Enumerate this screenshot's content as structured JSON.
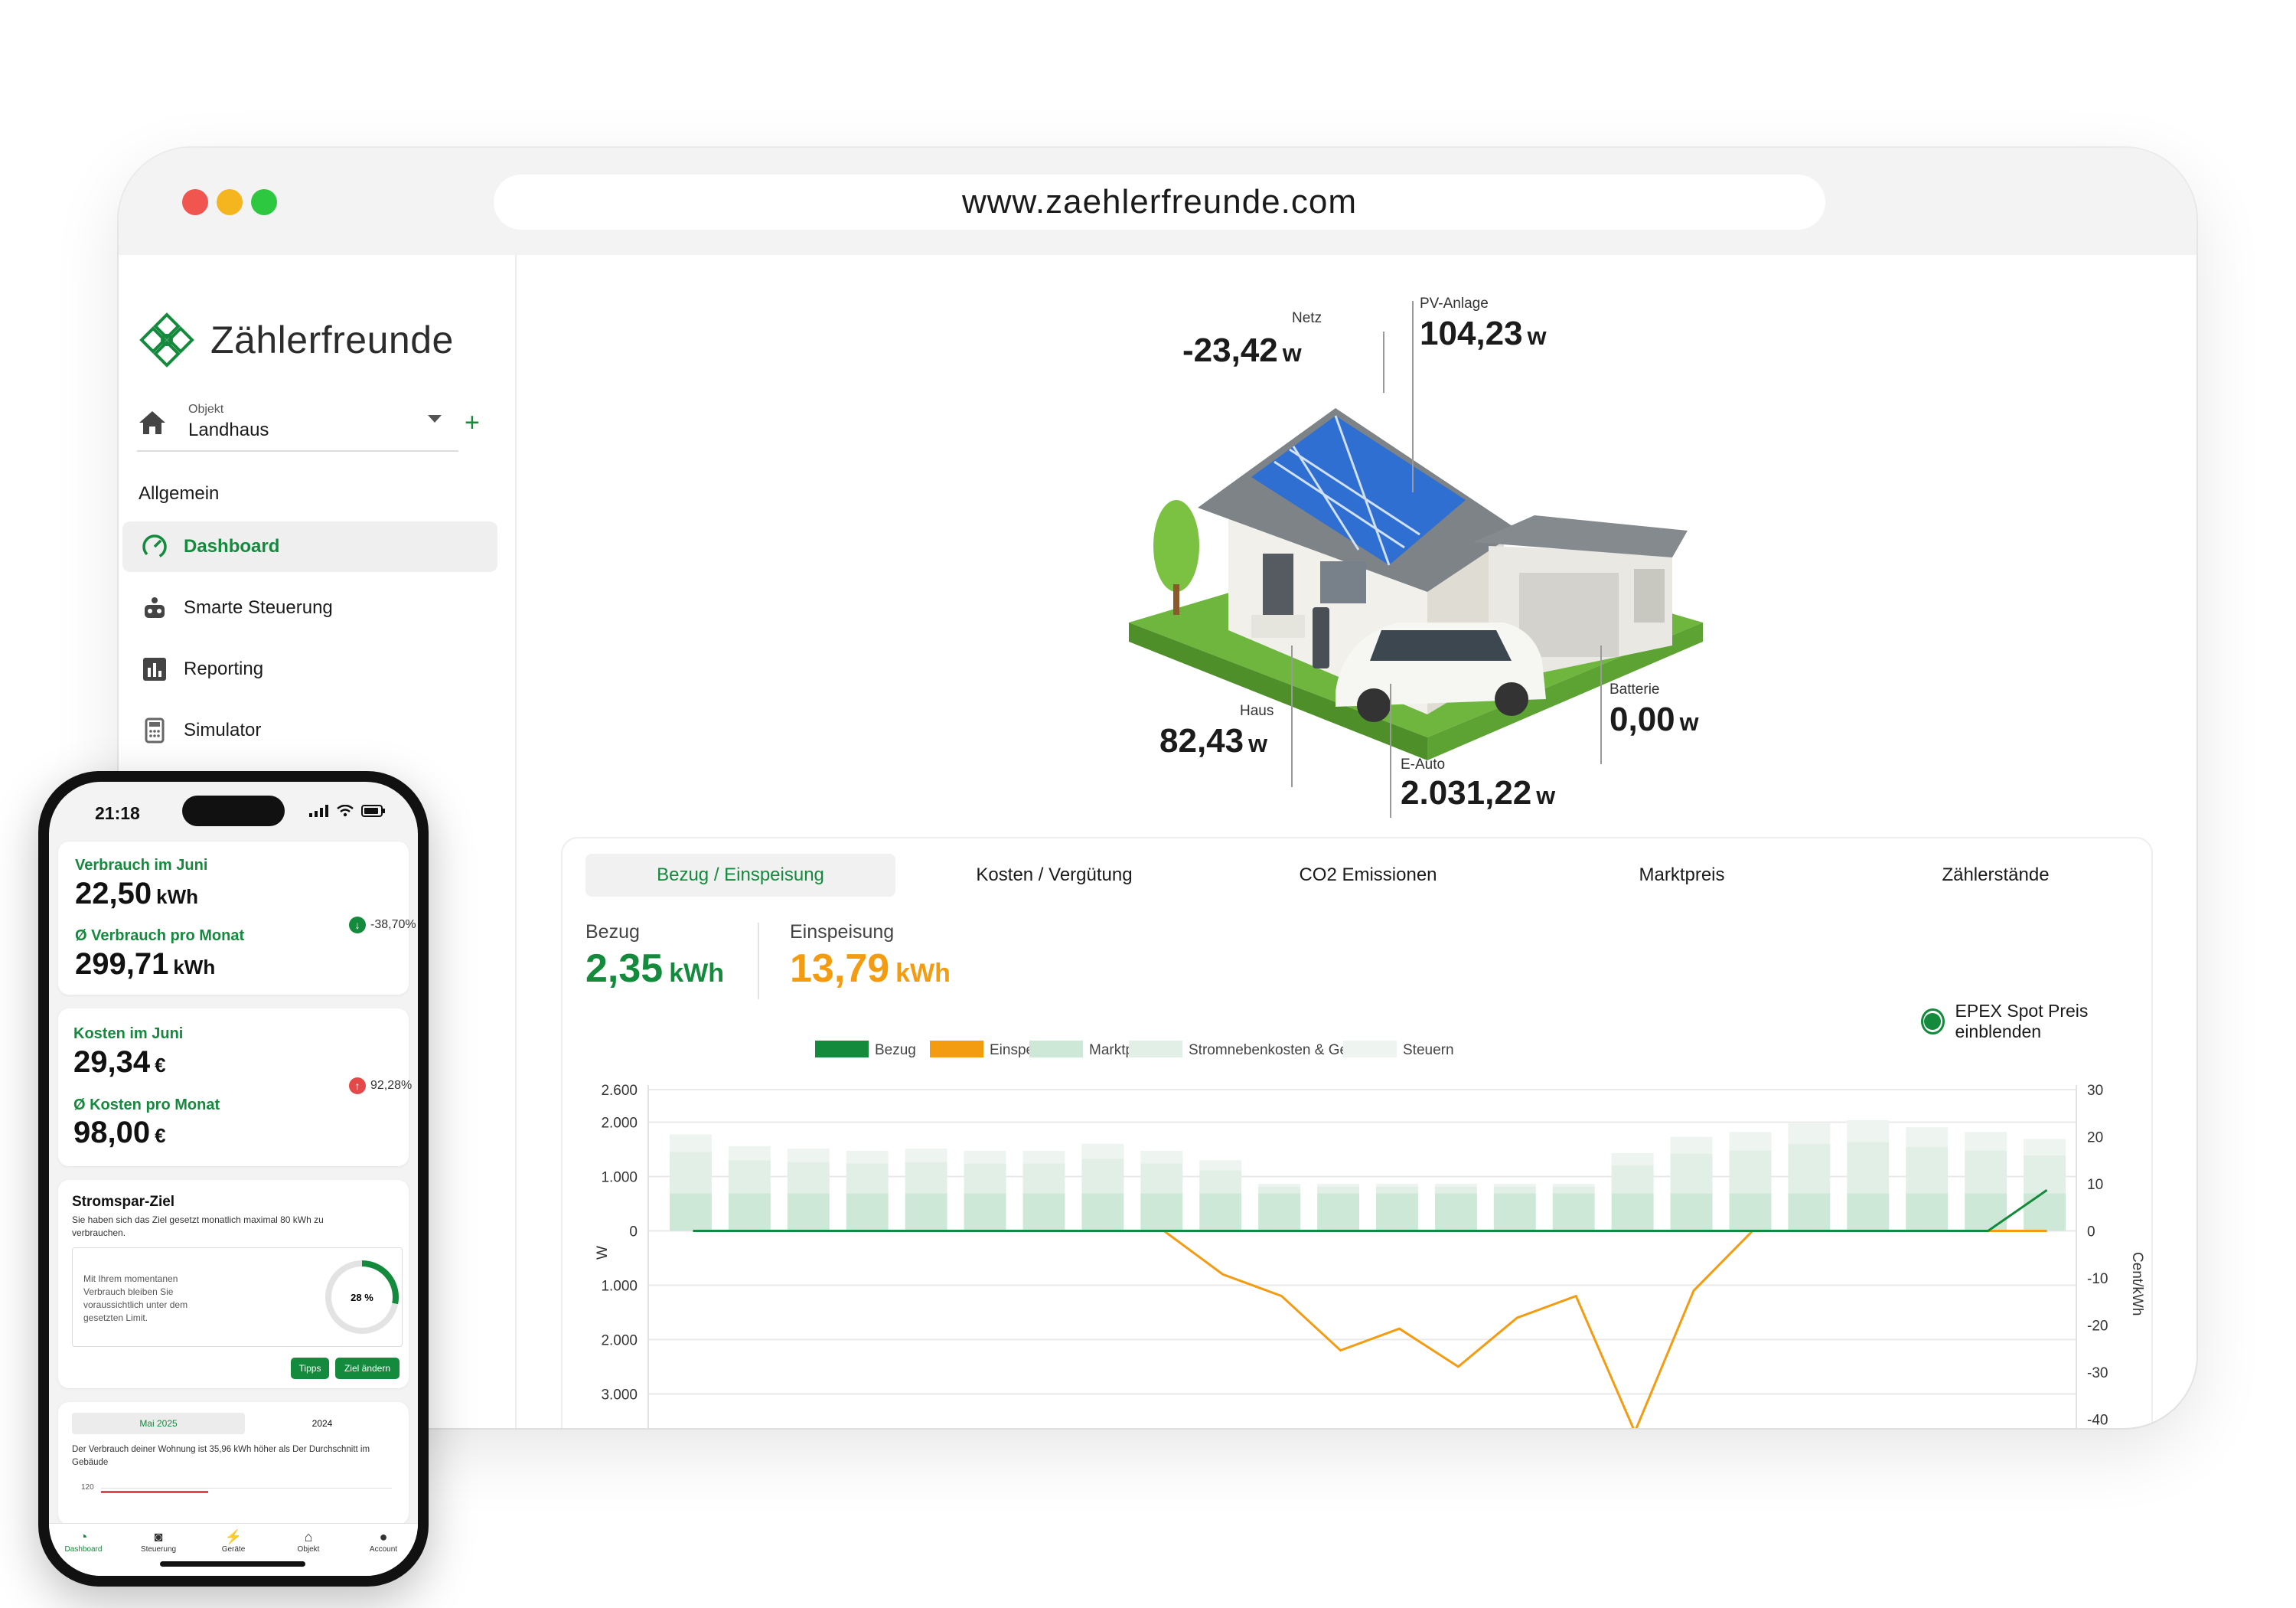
{
  "browser": {
    "url": "www.zaehlerfreunde.com"
  },
  "sidebar": {
    "brand": "Zählerfreunde",
    "object_label": "Objekt",
    "object_value": "Landhaus",
    "section": "Allgemein",
    "items": [
      {
        "label": "Dashboard",
        "icon": "gauge-icon",
        "active": true
      },
      {
        "label": "Smarte Steuerung",
        "icon": "robot-icon"
      },
      {
        "label": "Reporting",
        "icon": "bar-chart-icon"
      },
      {
        "label": "Simulator",
        "icon": "calculator-icon"
      }
    ]
  },
  "flow": {
    "netz": {
      "label": "Netz",
      "value": "-23,42",
      "unit": "w"
    },
    "pv": {
      "label": "PV-Anlage",
      "value": "104,23",
      "unit": "w"
    },
    "haus": {
      "label": "Haus",
      "value": "82,43",
      "unit": "w"
    },
    "batterie": {
      "label": "Batterie",
      "value": "0,00",
      "unit": "w"
    },
    "eauto": {
      "label": "E-Auto",
      "value": "2.031,22",
      "unit": "w"
    }
  },
  "tabs": [
    "Bezug / Einspeisung",
    "Kosten / Vergütung",
    "CO2 Emissionen",
    "Marktpreis",
    "Zählerstände"
  ],
  "kpi": {
    "bezug": {
      "label": "Bezug",
      "value": "2,35",
      "unit": "kWh"
    },
    "einspeisung": {
      "label": "Einspeisung",
      "value": "13,79",
      "unit": "kWh"
    }
  },
  "epex_toggle": "EPEX Spot Preis einblenden",
  "colors": {
    "green": "#138a3c",
    "orange": "#f39c12",
    "price": "#cde8d6",
    "fees": "#e2efe6",
    "tax": "#eef4f0"
  },
  "chart_data": {
    "type": "bar",
    "legend": [
      "Bezug",
      "Einspeisung",
      "Marktpreis",
      "Stromnebenkosten & Gebühren",
      "Steuern"
    ],
    "ylabel_left": "W",
    "ylabel_right": "Cent/kWh",
    "yticks_left": [
      "2.600",
      "2.000",
      "1.000",
      "0",
      "1.000",
      "2.000",
      "3.000"
    ],
    "yticks_right": [
      "30",
      "20",
      "10",
      "0",
      "-10",
      "-20",
      "-30",
      "-40"
    ],
    "price_cent_kwh": [
      20.5,
      18,
      17.5,
      17,
      17.5,
      17,
      17,
      18.5,
      17,
      15,
      10,
      10,
      10,
      10,
      10,
      10,
      16.5,
      20,
      21,
      23,
      23.5,
      22,
      21,
      19.5
    ],
    "bezug_w": [
      0,
      0,
      0,
      0,
      0,
      0,
      0,
      0,
      0,
      0,
      0,
      0,
      0,
      0,
      0,
      0,
      0,
      0,
      0,
      0,
      0,
      0,
      0,
      750
    ],
    "einspeisung_w": [
      0,
      0,
      0,
      0,
      0,
      0,
      0,
      0,
      0,
      -800,
      -1200,
      -2200,
      -1800,
      -2500,
      -1600,
      -1200,
      -3700,
      -1100,
      0,
      0,
      0,
      0,
      0,
      0
    ],
    "y_range_left": [
      -3700,
      2600
    ],
    "y_range_right": [
      -40,
      30
    ]
  },
  "phone": {
    "time": "21:18",
    "consumption": {
      "title": "Verbrauch im Juni",
      "value": "22,50",
      "unit": "kWh",
      "change": "-38,70%",
      "avg_title": "Ø Verbrauch pro Monat",
      "avg_value": "299,71",
      "avg_unit": "kWh"
    },
    "costs": {
      "title": "Kosten im Juni",
      "value": "29,34",
      "unit": "€",
      "change": "92,28%",
      "avg_title": "Ø Kosten pro Monat",
      "avg_value": "98,00",
      "avg_unit": "€"
    },
    "goal": {
      "title": "Stromspar-Ziel",
      "text": "Sie haben sich das Ziel gesetzt monatlich maximal 80 kWh zu verbrauchen.",
      "inner": "Mit Ihrem momentanen Verbrauch bleiben Sie voraussichtlich unter dem gesetzten Limit.",
      "percent": "28 %",
      "percent_value": 28,
      "btn_tips": "Tipps",
      "btn_change": "Ziel ändern"
    },
    "compare": {
      "tab_a": "Mai 2025",
      "tab_b": "2024",
      "text": "Der Verbrauch deiner Wohnung ist 35,96 kWh höher als Der Durchschnitt im Gebäude",
      "tick": "120"
    },
    "nav": [
      "Dashboard",
      "Steuerung",
      "Geräte",
      "Objekt",
      "Account"
    ]
  }
}
